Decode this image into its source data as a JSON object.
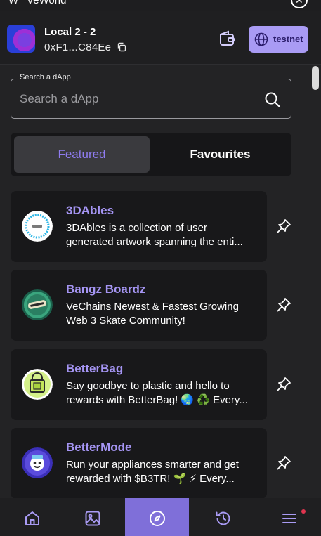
{
  "window": {
    "title": "VeWorld",
    "logo": "W"
  },
  "account": {
    "name": "Local 2 - 2",
    "address": "0xF1...C84Ee"
  },
  "network": {
    "label": "testnet"
  },
  "search": {
    "legend": "Search a dApp",
    "placeholder": "Search a dApp",
    "value": ""
  },
  "tabs": [
    {
      "label": "Featured",
      "active": true
    },
    {
      "label": "Favourites",
      "active": false
    }
  ],
  "dapps": [
    {
      "name": "3DAbles",
      "line1": "3DAbles is a collection of user",
      "line2": "generated artwork spanning the enti...",
      "icon": "3dables-logo"
    },
    {
      "name": "Bangz Boardz",
      "line1": "VeChains Newest & Fastest Growing",
      "line2": "Web 3 Skate Community!",
      "icon": "bangz-logo"
    },
    {
      "name": "BetterBag",
      "line1": "Say goodbye to plastic and hello to",
      "line2": "rewards with BetterBag! 🌏 ♻️ Every...",
      "icon": "betterbag-logo"
    },
    {
      "name": "BetterMode",
      "line1": "Run your appliances smarter and get",
      "line2": "rewarded with $B3TR! 🌱 ⚡ Every...",
      "icon": "bettermode-logo"
    }
  ],
  "nav": [
    {
      "icon": "home-icon",
      "active": false
    },
    {
      "icon": "gallery-icon",
      "active": false
    },
    {
      "icon": "compass-icon",
      "active": true
    },
    {
      "icon": "history-icon",
      "active": false
    },
    {
      "icon": "menu-icon",
      "active": false,
      "notification": true
    }
  ],
  "colors": {
    "accent": "#a99bf4",
    "background": "#232325",
    "card": "#18181a",
    "active_nav": "#7f6fd9"
  }
}
